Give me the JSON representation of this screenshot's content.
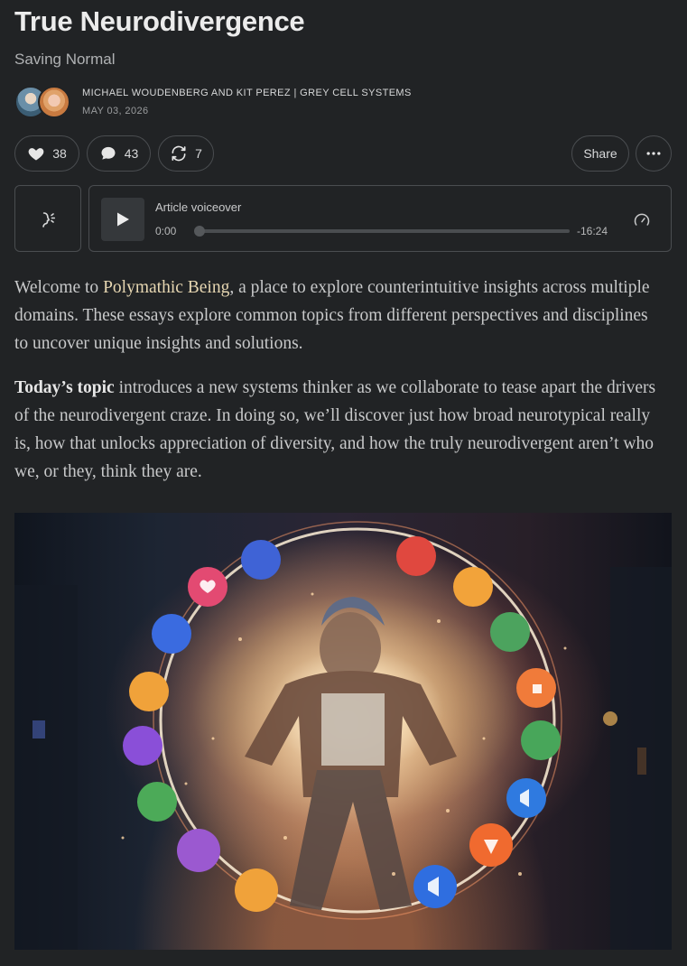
{
  "post": {
    "title": "True Neurodivergence",
    "subtitle": "Saving Normal",
    "authors": "MICHAEL WOUDENBERG AND KIT PEREZ | GREY CELL SYSTEMS",
    "date": "MAY 03, 2026"
  },
  "actions": {
    "likes": "38",
    "comments": "43",
    "restacks": "7",
    "share_label": "Share"
  },
  "voiceover": {
    "label": "Article voiceover",
    "current_time": "0:00",
    "remaining_time": "-16:24",
    "progress": 0
  },
  "body": {
    "p1_prefix": "Welcome to ",
    "p1_link": "Polymathic Being",
    "p1_suffix": ", a place to explore counterintuitive insights across multiple domains. These essays explore common topics from different perspectives and disciplines to uncover unique insights and solutions.",
    "p2_bold": "Today’s topic",
    "p2_rest": " introduces a new systems thinker as we collaborate to tease apart the drivers of the neurodivergent craze. In doing so, we’ll discover just how broad neurotypical really is, how that unlocks appreciation of diversity, and how the truly neurodivergent aren’t who we, or they, think they are."
  },
  "icons": {
    "like": "heart-icon",
    "comment": "speech-bubble-icon",
    "restack": "restack-icon",
    "more": "ellipsis-icon",
    "voice": "speaking-head-icon",
    "play": "play-icon",
    "speed": "speedometer-icon"
  },
  "colors": {
    "background": "#212325",
    "border": "#4a4d50",
    "link": "#e7d7b2"
  }
}
